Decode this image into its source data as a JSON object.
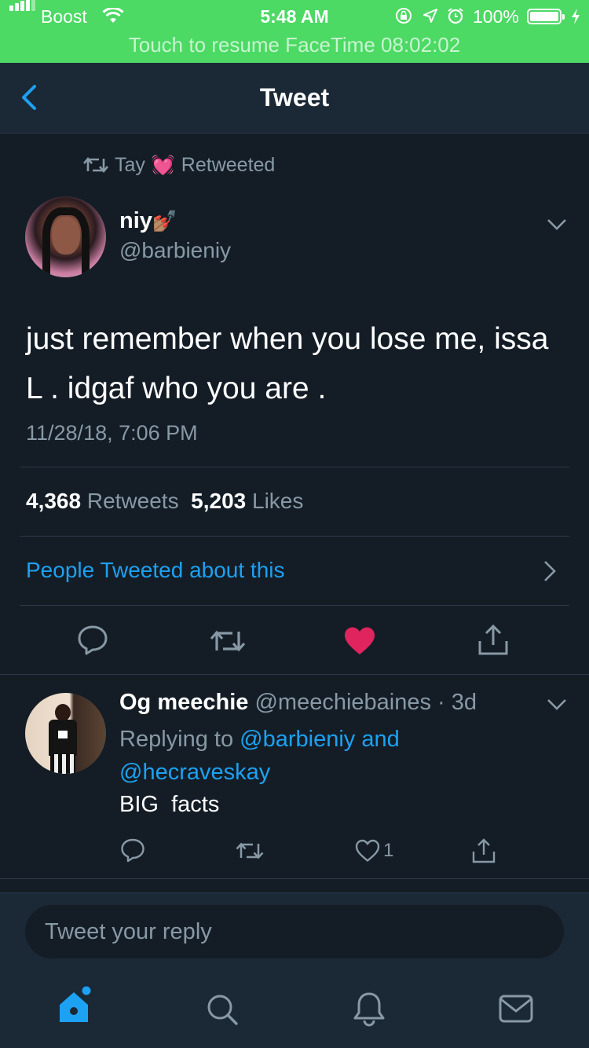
{
  "status_bar": {
    "carrier": "Boost",
    "time": "5:48 AM",
    "battery": "100%",
    "facetime_banner": "Touch to resume FaceTime 08:02:02",
    "bar_color": "#4cd964"
  },
  "nav": {
    "title": "Tweet",
    "back_icon": "chevron-left-icon"
  },
  "tweet": {
    "retweet_by": "Tay",
    "retweet_emoji": "💓",
    "retweet_suffix": "Retweeted",
    "author_name": "niy",
    "author_emoji": "💅🏽",
    "author_handle": "@barbieniy",
    "text": "just remember when you lose me, issa L . idgaf who you are .",
    "timestamp": "11/28/18, 7:06 PM",
    "retweets_count": "4,368",
    "retweets_label": "Retweets",
    "likes_count": "5,203",
    "likes_label": "Likes",
    "people_link": "People Tweeted about this",
    "liked": true
  },
  "reply": {
    "author_name": "Og meechie",
    "author_handle": "@meechiebaines",
    "age": "· 3d",
    "replying_prefix": "Replying to",
    "replying_to_1": "@barbieniy",
    "replying_and": "and",
    "replying_to_2": "@hecraveskay",
    "text": "BIG  facts",
    "like_count": "1"
  },
  "compose": {
    "placeholder": "Tweet your reply"
  },
  "colors": {
    "background": "#141d26",
    "panel": "#1b2836",
    "accent": "#1da1f2",
    "like": "#e0245e",
    "muted": "#8899a6"
  }
}
